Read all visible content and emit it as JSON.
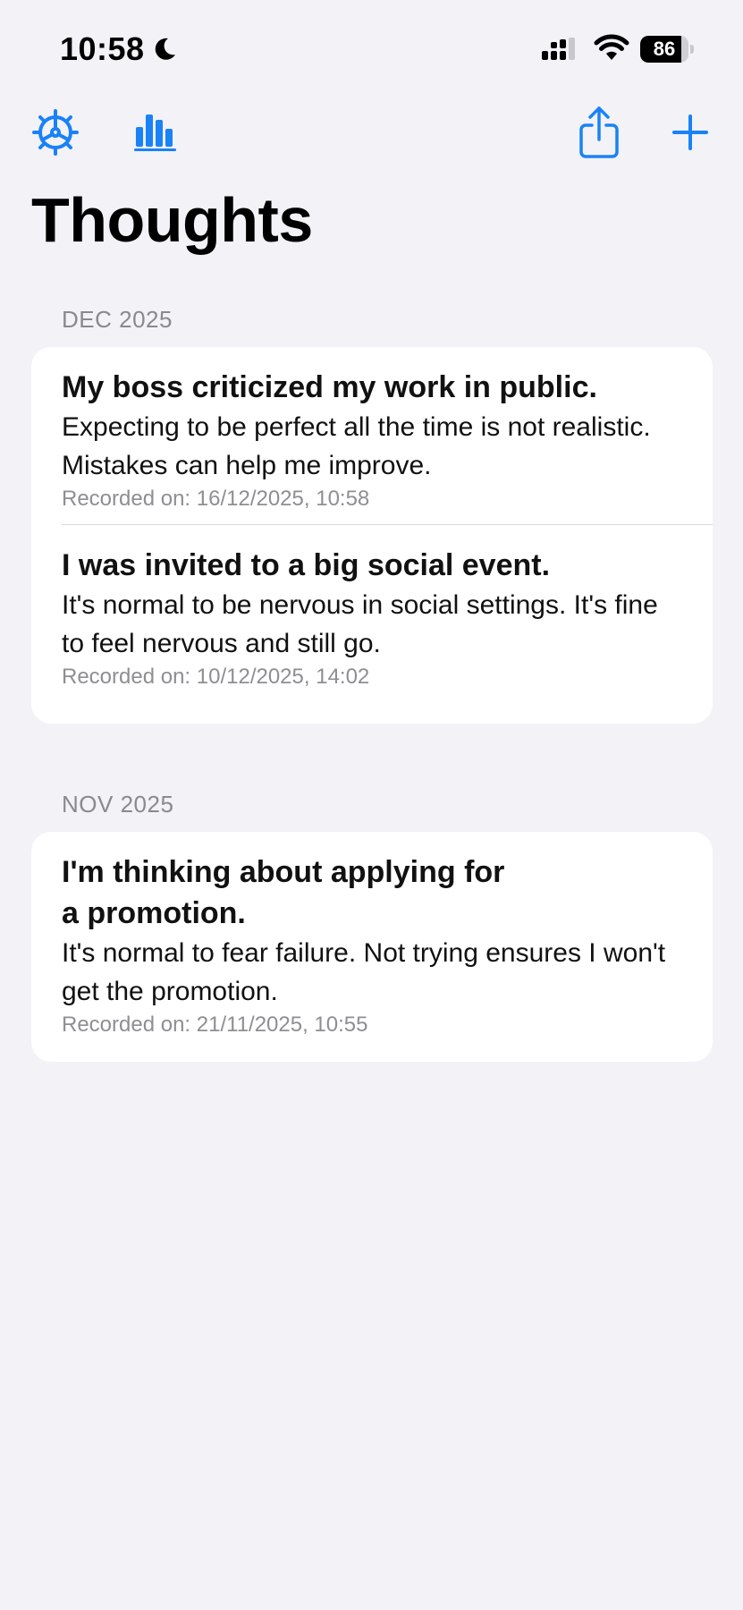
{
  "status_bar": {
    "time": "10:58",
    "battery_level": "86",
    "battery_fraction": 0.86
  },
  "toolbar": {
    "icons": [
      "gear-icon",
      "bar-chart-icon",
      "share-icon",
      "plus-icon"
    ],
    "accent_color": "#1a82f7"
  },
  "page": {
    "title": "Thoughts"
  },
  "sections": [
    {
      "header": "DEC 2025",
      "entries": [
        {
          "title": "My boss criticized my work in public.",
          "body": "Expecting to be perfect all the time is not realistic. Mistakes can help me improve.",
          "date": "Recorded on: 16/12/2025, 10:58"
        },
        {
          "title": "I was invited to a big social event.",
          "body": "It's normal to be nervous in social settings. It's fine to feel nervous and still go.",
          "date": "Recorded on: 10/12/2025, 14:02"
        }
      ]
    },
    {
      "header": "NOV 2025",
      "entries": [
        {
          "title_line1": "I'm thinking about applying for",
          "title_line2": "a promotion.",
          "body": "It's normal to fear failure. Not trying ensures I won't get the promotion.",
          "date": "Recorded on: 21/11/2025, 10:55"
        }
      ]
    }
  ]
}
